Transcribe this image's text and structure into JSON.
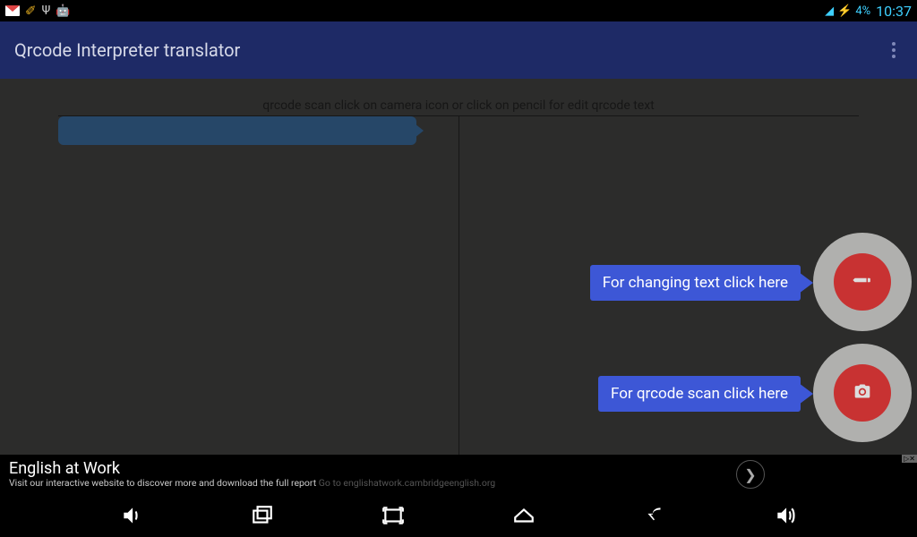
{
  "status": {
    "battery": "4%",
    "time": "10:37"
  },
  "app": {
    "title": "Qrcode Interpreter translator"
  },
  "hint": "qrcode scan click on camera icon or click on pencil for edit qrcode text",
  "tooltips": {
    "edit": "For changing text click here",
    "scan": "For qrcode scan click here"
  },
  "ad": {
    "title": "English at Work",
    "subtitle": "Visit our interactive website to discover more and download the full report",
    "url": "Go to englishatwork.cambridgeenglish.org",
    "badge": "▷✕"
  }
}
